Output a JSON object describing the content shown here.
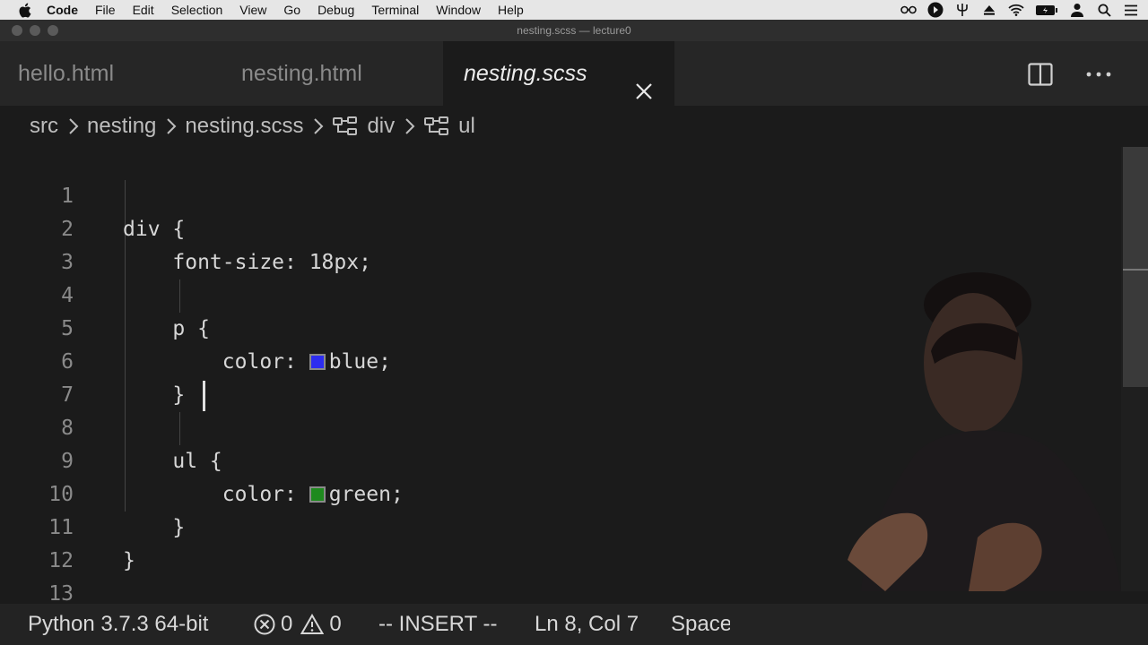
{
  "menubar": {
    "apple_icon": "apple-icon",
    "items": [
      "Code",
      "File",
      "Edit",
      "Selection",
      "View",
      "Go",
      "Debug",
      "Terminal",
      "Window",
      "Help"
    ],
    "status_icons": [
      "glasses-icon",
      "play-circle-icon",
      "pitchfork-icon",
      "eject-icon",
      "wifi-icon",
      "battery-icon",
      "user-icon",
      "search-icon",
      "list-icon"
    ]
  },
  "window": {
    "title": "nesting.scss — lecture0"
  },
  "tabs": [
    {
      "label": "hello.html",
      "active": false
    },
    {
      "label": "nesting.html",
      "active": false
    },
    {
      "label": "nesting.scss",
      "active": true
    }
  ],
  "breadcrumb": {
    "items": [
      "src",
      "nesting",
      "nesting.scss",
      "div",
      "ul"
    ]
  },
  "editor": {
    "lines": [
      {
        "n": "1",
        "code": "div {"
      },
      {
        "n": "2",
        "code": "    font-size: 18px;"
      },
      {
        "n": "3",
        "code": ""
      },
      {
        "n": "4",
        "code": "    p {"
      },
      {
        "n": "5",
        "code_before": "        color: ",
        "code_after": "blue;",
        "swatch": "#2d2df0"
      },
      {
        "n": "6",
        "code": "    }"
      },
      {
        "n": "7",
        "code": ""
      },
      {
        "n": "8",
        "code": "    ul {"
      },
      {
        "n": "9",
        "code_before": "        color: ",
        "code_after": "green;",
        "swatch": "#1e8a1e"
      },
      {
        "n": "10",
        "code": "    }"
      },
      {
        "n": "11",
        "code": "}"
      },
      {
        "n": "12",
        "code": ""
      },
      {
        "n": "13",
        "code": ""
      }
    ]
  },
  "statusbar": {
    "interpreter": "Python 3.7.3 64-bit",
    "errors": "0",
    "warnings": "0",
    "mode": "-- INSERT --",
    "position": "Ln 8, Col 7",
    "spaces": "Spaces"
  },
  "colors": {
    "editor_bg": "#1b1b1b",
    "tabbar_bg": "#262626",
    "statusbar_bg": "#232323"
  }
}
